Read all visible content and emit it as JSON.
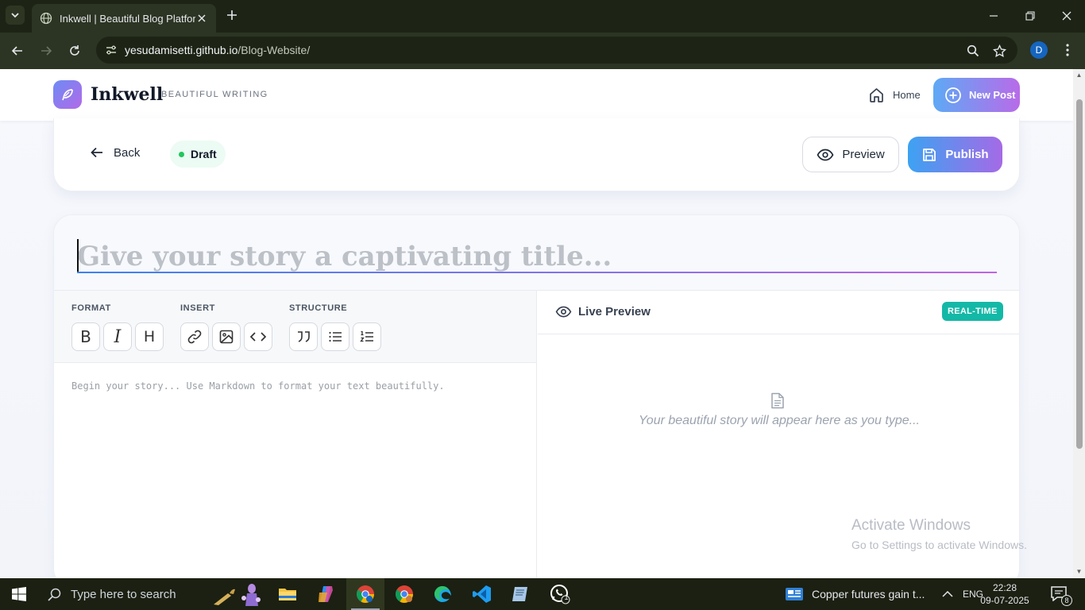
{
  "browser": {
    "tab_title": "Inkwell | Beautiful Blog Platform",
    "url_host": "yesudamisetti.github.io",
    "url_path": "/Blog-Website/",
    "profile_initial": "D"
  },
  "header": {
    "brand": "Inkwell",
    "tagline": "BEAUTIFUL WRITING",
    "home_label": "Home",
    "new_post_label": "New Post"
  },
  "actions": {
    "back_label": "Back",
    "status_label": "Draft",
    "preview_label": "Preview",
    "publish_label": "Publish"
  },
  "editor": {
    "title_placeholder": "Give your story a captivating title...",
    "title_value": "",
    "toolbar_groups": [
      {
        "label": "FORMAT"
      },
      {
        "label": "INSERT"
      },
      {
        "label": "STRUCTURE"
      }
    ],
    "format_buttons": {
      "bold": "B",
      "italic": "I",
      "heading": "H"
    },
    "content_placeholder": "Begin your story... Use Markdown to format your text beautifully.",
    "content_value": ""
  },
  "preview": {
    "title": "Live Preview",
    "badge": "REAL-TIME",
    "empty_message": "Your beautiful story will appear here as you type..."
  },
  "watermark": {
    "line1": "Activate Windows",
    "line2": "Go to Settings to activate Windows."
  },
  "taskbar": {
    "search_placeholder": "Type here to search",
    "news": "Copper futures gain t...",
    "language": "ENG",
    "time": "22:28",
    "date": "09-07-2025",
    "notification_count": "8",
    "whatsapp_badge": "1"
  },
  "colors": {
    "accent_gradient_start": "#3da2f2",
    "accent_gradient_end": "#a56ae6",
    "realtime_badge": "#14b8a6",
    "draft_dot": "#22c55e"
  }
}
